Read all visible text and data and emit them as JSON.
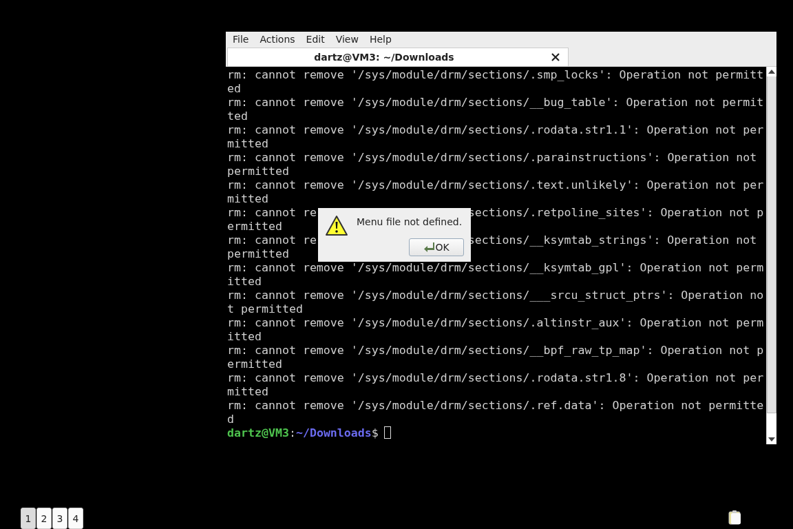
{
  "window": {
    "menu": [
      "File",
      "Actions",
      "Edit",
      "View",
      "Help"
    ],
    "tabs": [
      {
        "label": "dartz@VM3: ~/Downloads",
        "selected": true
      }
    ],
    "lines": [
      {
        "text": "rm: cannot remove '/sys/module/drm/sections/.smp_locks': Operation not permitt"
      },
      {
        "text": "ed"
      },
      {
        "text": "rm: cannot remove '/sys/module/drm/sections/__bug_table': Operation not permit"
      },
      {
        "text": "ted"
      },
      {
        "text": "rm: cannot remove '/sys/module/drm/sections/.rodata.str1.1': Operation not per"
      },
      {
        "text": "mitted"
      },
      {
        "text": "rm: cannot remove '/sys/module/drm/sections/.parainstructions': Operation not"
      },
      {
        "text": "permitted"
      },
      {
        "text": "rm: cannot remove '/sys/module/drm/sections/.text.unlikely': Operation not per"
      },
      {
        "text": "mitted"
      },
      {
        "text": "rm: cannot re",
        "text_after_dialog": "sections/.retpoline_sites': Operation not p"
      },
      {
        "text": "ermitted"
      },
      {
        "text": "rm: cannot re",
        "text_after_dialog": "sections/__ksymtab_strings': Operation not"
      },
      {
        "text": "permitted"
      },
      {
        "text": "rm: cannot remove '/sys/module/drm/sections/__ksymtab_gpl': Operation not perm"
      },
      {
        "text": "itted"
      },
      {
        "text": "rm: cannot remove '/sys/module/drm/sections/___srcu_struct_ptrs': Operation no"
      },
      {
        "text": "t permitted"
      },
      {
        "text": "rm: cannot remove '/sys/module/drm/sections/.altinstr_aux': Operation not perm"
      },
      {
        "text": "itted"
      },
      {
        "text": "rm: cannot remove '/sys/module/drm/sections/__bpf_raw_tp_map': Operation not p"
      },
      {
        "text": "ermitted"
      },
      {
        "text": "rm: cannot remove '/sys/module/drm/sections/.rodata.str1.8': Operation not per"
      },
      {
        "text": "mitted"
      },
      {
        "text": "rm: cannot remove '/sys/module/drm/sections/.ref.data': Operation not permitte"
      },
      {
        "text": "d"
      }
    ],
    "prompt": {
      "user_host": "dartz@VM3",
      "separator": ":",
      "path": "~/Downloads",
      "symbol": "$"
    }
  },
  "dialog": {
    "message": "Menu file not defined.",
    "button": "OK"
  },
  "pager": [
    {
      "label": "1",
      "selected": true
    },
    {
      "label": "2",
      "selected": false
    },
    {
      "label": "3",
      "selected": false
    },
    {
      "label": "4",
      "selected": false
    }
  ]
}
